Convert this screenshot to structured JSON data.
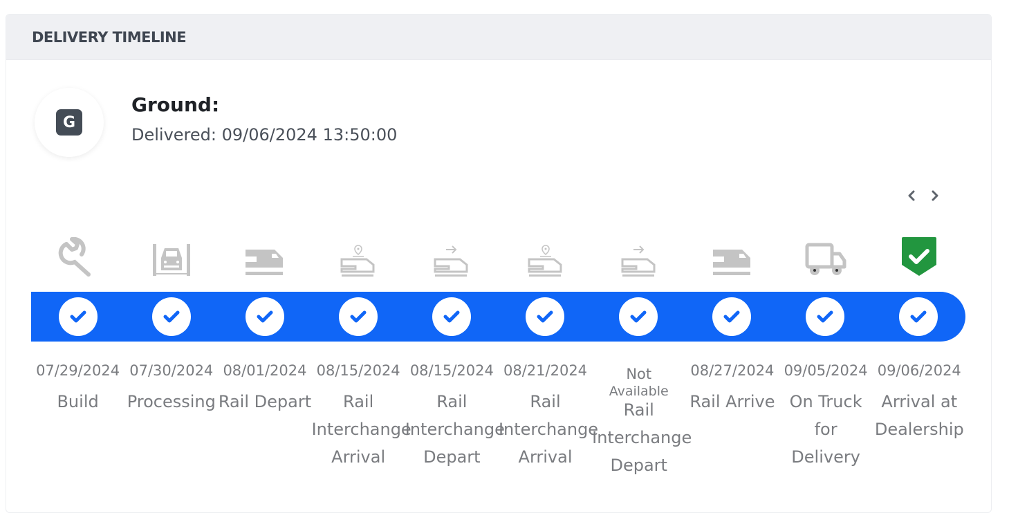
{
  "card": {
    "title": "DELIVERY TIMELINE"
  },
  "mode": {
    "badge": "G",
    "title": "Ground:",
    "status": "Delivered: 09/06/2024 13:50:00"
  },
  "nav": {
    "prev_icon": "chevron-left-icon",
    "next_icon": "chevron-right-icon"
  },
  "colors": {
    "progress_bar": "#1066f7",
    "icon_inactive": "#c4c4c4",
    "icon_complete": "#22963f",
    "header_bg": "#eff0f3",
    "text_muted": "#7a7c80"
  },
  "steps": [
    {
      "icon": "wrench-icon",
      "date": "07/29/2024",
      "name": "Build",
      "complete": true
    },
    {
      "icon": "car-lift-icon",
      "date": "07/30/2024",
      "name": "Processing",
      "complete": true
    },
    {
      "icon": "train-icon",
      "date": "08/01/2024",
      "name": "Rail Depart",
      "complete": true
    },
    {
      "icon": "train-location-pin-icon",
      "date": "08/15/2024",
      "name": "Rail Interchange Arrival",
      "complete": true
    },
    {
      "icon": "train-arrow-icon",
      "date": "08/15/2024",
      "name": "Rail Interchange Depart",
      "complete": true
    },
    {
      "icon": "train-location-pin-icon",
      "date": "08/21/2024",
      "name": "Rail Interchange Arrival",
      "complete": true
    },
    {
      "icon": "train-arrow-icon",
      "date_line1": "Not",
      "date_line2": "Available",
      "name": "Rail Interchange Depart",
      "complete": true
    },
    {
      "icon": "train-icon",
      "date": "08/27/2024",
      "name": "Rail Arrive",
      "complete": true
    },
    {
      "icon": "truck-icon",
      "date": "09/05/2024",
      "name": "On Truck for Delivery",
      "complete": true
    },
    {
      "icon": "shield-check-icon",
      "date": "09/06/2024",
      "name": "Arrival at Dealership",
      "complete": true
    }
  ]
}
